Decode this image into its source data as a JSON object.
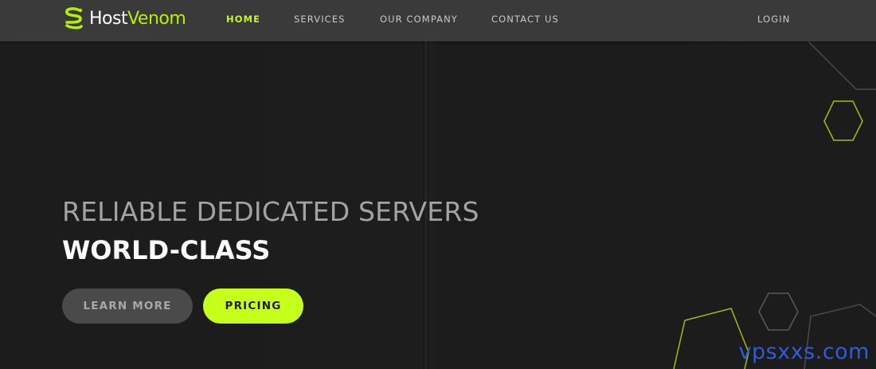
{
  "brand": {
    "name_part1": "Host",
    "name_part2": "Venom",
    "accent_color": "#c6ff1a"
  },
  "nav": {
    "items": [
      {
        "label": "HOME",
        "active": true
      },
      {
        "label": "SERVICES",
        "active": false
      },
      {
        "label": "OUR COMPANY",
        "active": false
      },
      {
        "label": "CONTACT US",
        "active": false
      }
    ],
    "login_label": "LOGIN"
  },
  "hero": {
    "headline": "RELIABLE DEDICATED SERVERS",
    "subheadline": "WORLD-CLASS",
    "learn_more_label": "LEARN MORE",
    "pricing_label": "PRICING"
  },
  "watermark": {
    "text": "vpsxxs.com"
  },
  "icons": [
    "snake-logo-icon",
    "hexagon-decoration-icon"
  ]
}
